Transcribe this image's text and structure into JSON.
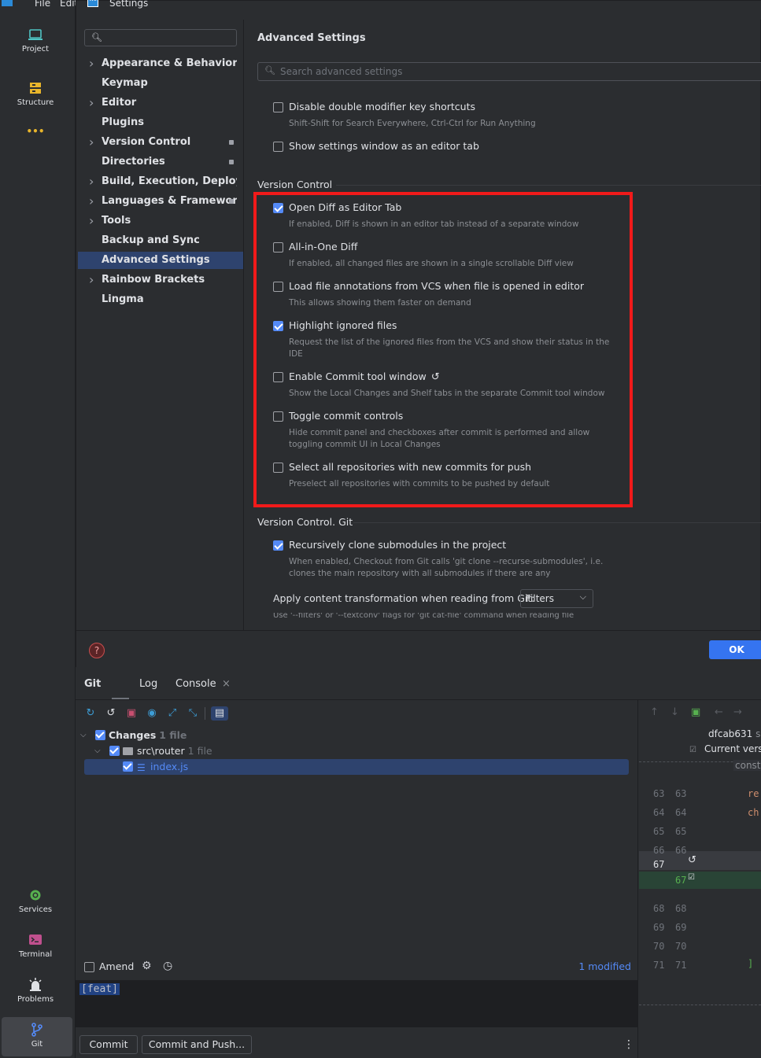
{
  "menu": {
    "file": "File",
    "edit": "Edit"
  },
  "tool_strip": {
    "project": "Project",
    "structure": "Structure",
    "more": "•••",
    "services": "Services",
    "terminal": "Terminal",
    "problems": "Problems",
    "git": "Git"
  },
  "dialog": {
    "title": "Settings",
    "logo": "WS",
    "nav": [
      {
        "label": "Appearance & Behavior",
        "expandable": true
      },
      {
        "label": "Keymap",
        "expandable": false
      },
      {
        "label": "Editor",
        "expandable": true
      },
      {
        "label": "Plugins",
        "expandable": false
      },
      {
        "label": "Version Control",
        "expandable": true,
        "badge": true
      },
      {
        "label": "Directories",
        "expandable": false,
        "badge": true
      },
      {
        "label": "Build, Execution, Deployment",
        "expandable": true
      },
      {
        "label": "Languages & Frameworks",
        "expandable": true,
        "badge": true
      },
      {
        "label": "Tools",
        "expandable": true
      },
      {
        "label": "Backup and Sync",
        "expandable": false
      },
      {
        "label": "Advanced Settings",
        "expandable": false,
        "selected": true
      },
      {
        "label": "Rainbow Brackets",
        "expandable": true
      },
      {
        "label": "Lingma",
        "expandable": false
      }
    ],
    "content_title": "Advanced Settings",
    "search_placeholder": "Search advanced settings",
    "general_options": [
      {
        "title": "Disable double modifier key shortcuts",
        "desc": "Shift-Shift for Search Everywhere, Ctrl-Ctrl for Run Anything",
        "checked": false
      },
      {
        "title": "Show settings window as an editor tab",
        "desc": "",
        "checked": false
      }
    ],
    "vc_section": "Version Control",
    "vc_options": [
      {
        "title": "Open Diff as Editor Tab",
        "desc": "If enabled, Diff is shown in an editor tab instead of a separate window",
        "checked": true
      },
      {
        "title": "All-in-One Diff",
        "desc": "If enabled, all changed files are shown in a single scrollable Diff view",
        "checked": false
      },
      {
        "title": "Load file annotations from VCS when file is opened in editor",
        "desc": "This allows showing them faster on demand",
        "checked": false
      },
      {
        "title": "Highlight ignored files",
        "desc": "Request the list of the ignored files from the VCS and show their status in the IDE",
        "checked": true
      },
      {
        "title": "Enable Commit tool window",
        "desc": "Show the Local Changes and Shelf tabs in the separate Commit tool window",
        "checked": false,
        "reset_icon": "↺"
      },
      {
        "title": "Toggle commit controls",
        "desc": "Hide commit panel and checkboxes after commit is performed and allow toggling commit UI in Local Changes",
        "checked": false
      },
      {
        "title": "Select all repositories with new commits for push",
        "desc": "Preselect all repositories with commits to be pushed by default",
        "checked": false
      }
    ],
    "git_section": "Version Control. Git",
    "git_options": [
      {
        "title": "Recursively clone submodules in the project",
        "desc": "When enabled, Checkout from Git calls 'git clone --recurse-submodules', i.e. clones the main repository with all submodules if there are any",
        "checked": true
      }
    ],
    "transform_label": "Apply content transformation when reading from Git:",
    "transform_value": "Filters",
    "cut_text": "Use '--filters' or '--textconv' flags for 'git cat-file' command when reading file",
    "help": "?",
    "ok": "OK"
  },
  "git_window": {
    "tabs": [
      "Git",
      "Log",
      "Console"
    ],
    "close_glyph": "×",
    "tree": {
      "changes": "Changes",
      "changes_count": "1 file",
      "folder": "src\\router",
      "folder_count": "1 file",
      "file": "index.js"
    },
    "amend": "Amend",
    "modified": "1 modified",
    "commit_message": "[feat]",
    "commit_button": "Commit",
    "commit_push_button": "Commit and Push...",
    "more": "⋮"
  },
  "diff": {
    "hash": "dfcab631",
    "hash_tail": "s",
    "current": "Current vers",
    "const_token": "consta",
    "lines": [
      "63",
      "64",
      "65",
      "66",
      "67",
      "67",
      "68",
      "69",
      "70",
      "71"
    ],
    "tok_re": "re",
    "tok_ch": "ch",
    "tok_close": "]"
  },
  "colors": {
    "highlight_box": "#f11a1a",
    "accent": "#3574f0",
    "selection": "#2e436e"
  }
}
